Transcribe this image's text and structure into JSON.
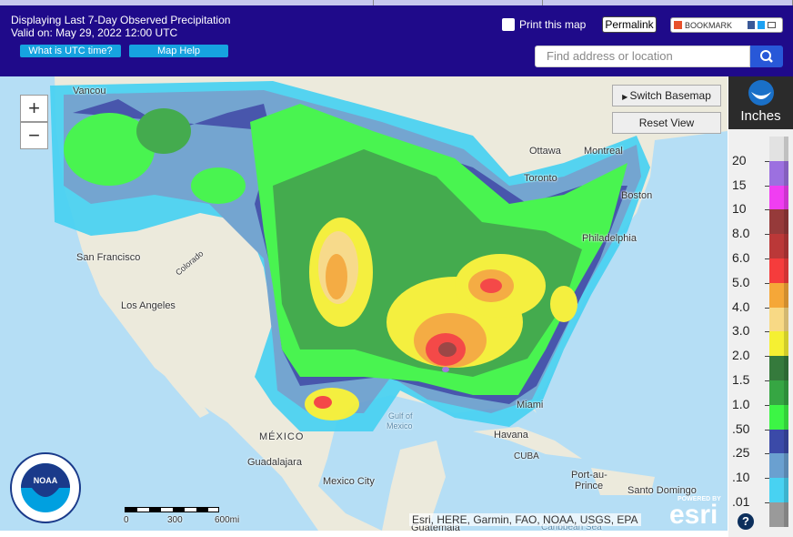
{
  "header": {
    "title": "Displaying Last 7-Day Observed Precipitation",
    "valid": "Valid on: May 29, 2022 12:00 UTC",
    "utc_button": "What is UTC time?",
    "help_button": "Map Help",
    "print": "Print this map",
    "permalink": "Permalink",
    "bookmark": "BOOKMARK",
    "search_placeholder": "Find address or location"
  },
  "map": {
    "switch_basemap": "Switch Basemap",
    "reset_view": "Reset View",
    "zoom_in": "+",
    "zoom_out": "−",
    "attribution": "Esri, HERE, Garmin, FAO, NOAA, USGS, EPA",
    "powered_by": "POWERED BY",
    "esri": "esri",
    "scale": [
      "0",
      "300",
      "600mi"
    ],
    "labels": [
      {
        "t": "Vancou"
      },
      {
        "t": "San Francisco"
      },
      {
        "t": "Los Angeles"
      },
      {
        "t": "Colorado"
      },
      {
        "t": "Ottawa"
      },
      {
        "t": "Montreal"
      },
      {
        "t": "Toronto"
      },
      {
        "t": "Boston"
      },
      {
        "t": "Philadelphia"
      },
      {
        "t": "Miami"
      },
      {
        "t": "Havana"
      },
      {
        "t": "Gulf of"
      },
      {
        "t": "Mexico"
      },
      {
        "t": "MÉXICO"
      },
      {
        "t": "Guadalajara"
      },
      {
        "t": "Mexico City"
      },
      {
        "t": "CUBA"
      },
      {
        "t": "Port-au-"
      },
      {
        "t": "Prince"
      },
      {
        "t": "Santo Domingo"
      },
      {
        "t": "Guatemala"
      },
      {
        "t": "Caribbean Sea"
      }
    ]
  },
  "legend": {
    "unit": "Inches",
    "help": "?",
    "levels": [
      {
        "v": "",
        "c": "#e2e2e2"
      },
      {
        "v": "20",
        "c": "#9c70e0"
      },
      {
        "v": "15",
        "c": "#f03ef2"
      },
      {
        "v": "10",
        "c": "#963a3a"
      },
      {
        "v": "8.0",
        "c": "#bb3838"
      },
      {
        "v": "6.0",
        "c": "#f53c3c"
      },
      {
        "v": "5.0",
        "c": "#f5a738"
      },
      {
        "v": "4.0",
        "c": "#f8d985"
      },
      {
        "v": "3.0",
        "c": "#f5f032"
      },
      {
        "v": "2.0",
        "c": "#357a3c"
      },
      {
        "v": "1.5",
        "c": "#36a643"
      },
      {
        "v": "1.0",
        "c": "#3cf545"
      },
      {
        "v": ".50",
        "c": "#3b4aa8"
      },
      {
        "v": ".25",
        "c": "#6aa0d0"
      },
      {
        "v": ".10",
        "c": "#48d2f2"
      },
      {
        "v": ".01",
        "c": "#9a9a9a"
      }
    ]
  },
  "colors": {
    "header": "#1f0a8a",
    "button": "#16a3e0",
    "search": "#2858d8"
  }
}
